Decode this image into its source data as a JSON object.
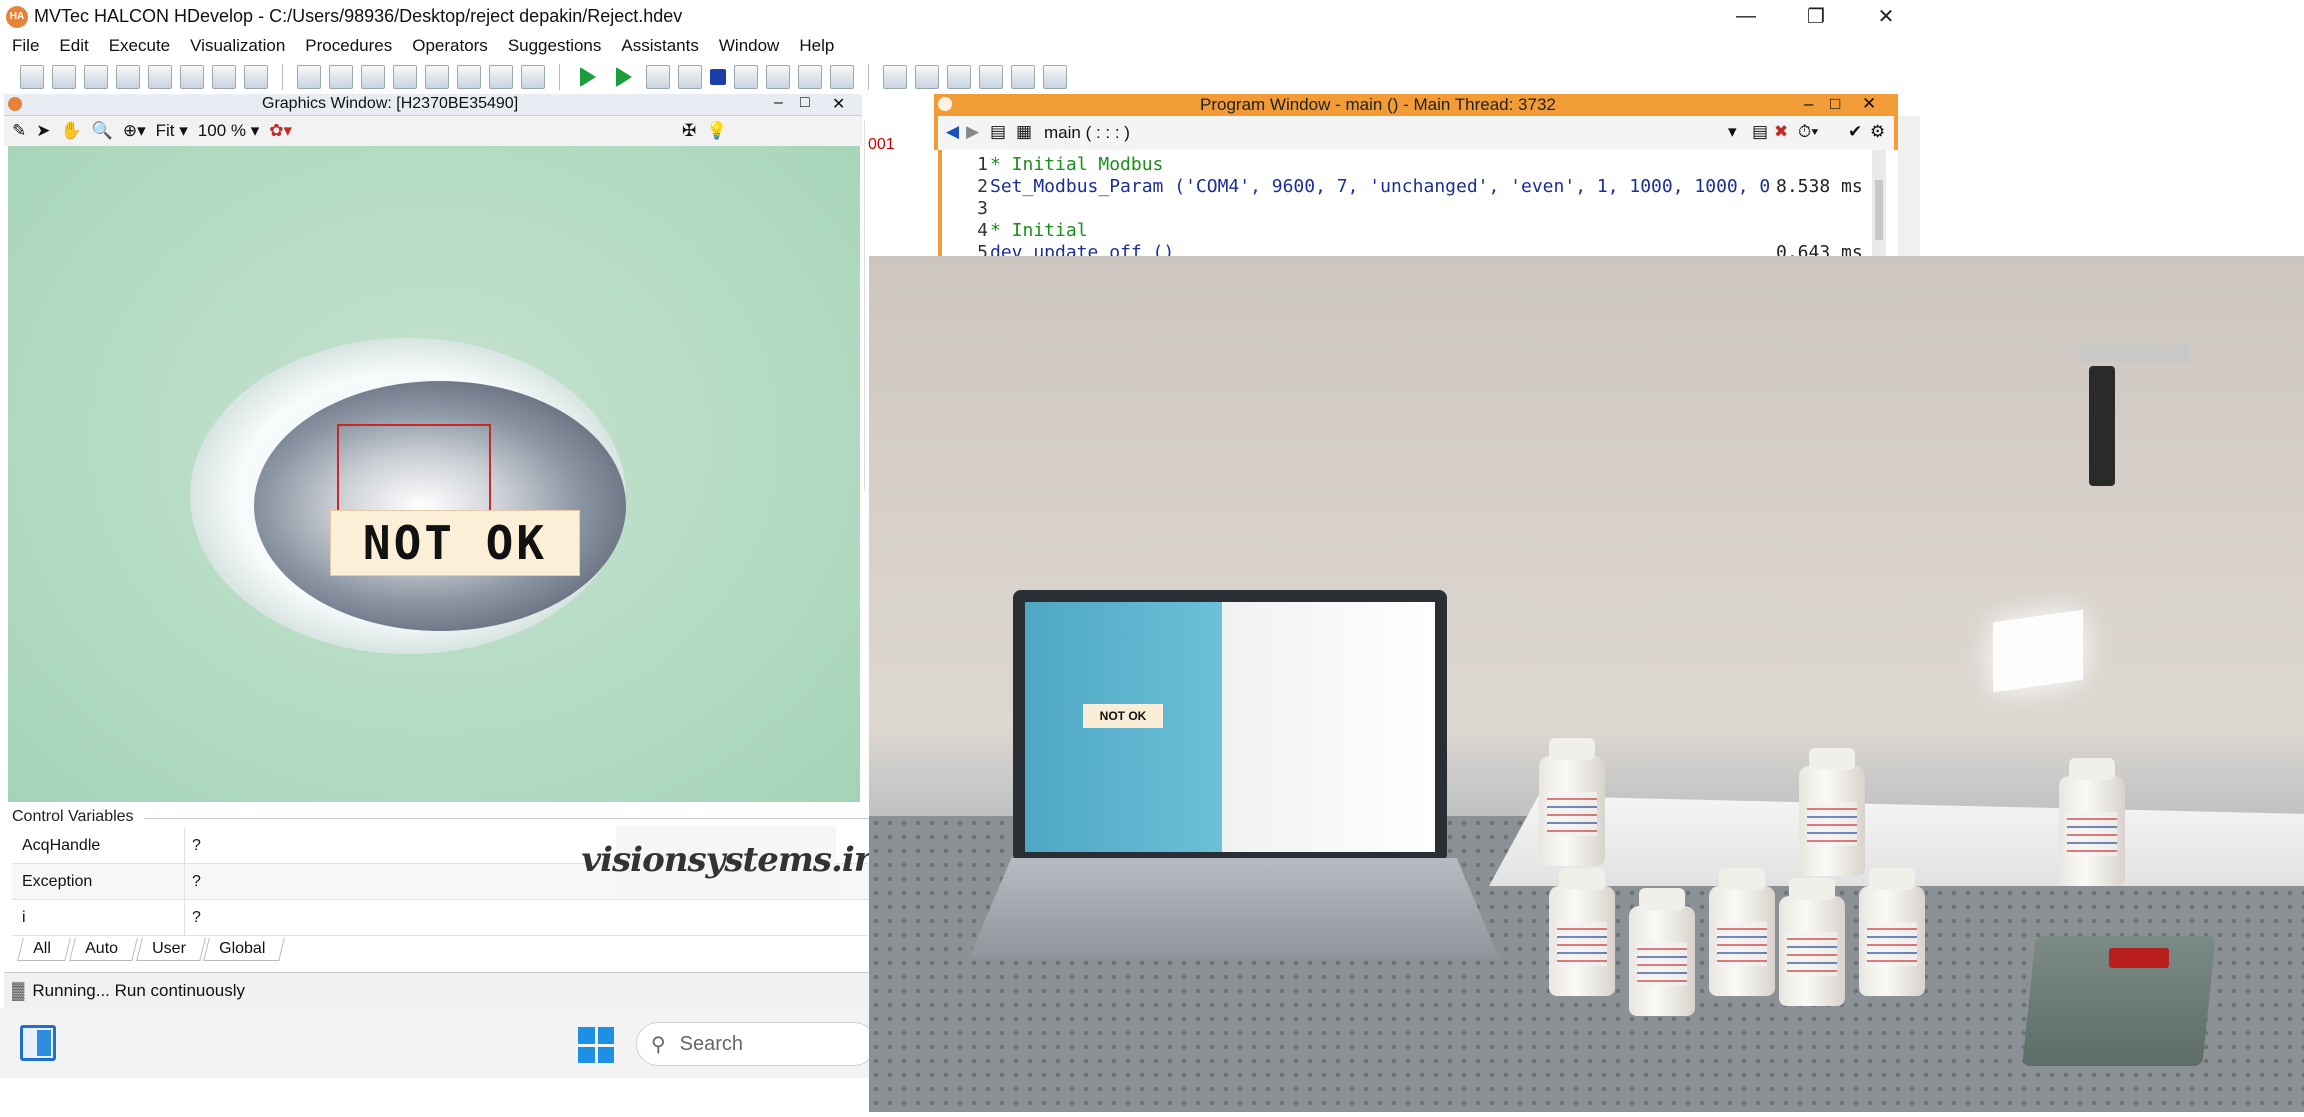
{
  "app": {
    "title": "MVTec HALCON HDevelop - C:/Users/98936/Desktop/reject depakin/Reject.hdev",
    "logo_text": "HA"
  },
  "menu": [
    "File",
    "Edit",
    "Execute",
    "Visualization",
    "Procedures",
    "Operators",
    "Suggestions",
    "Assistants",
    "Window",
    "Help"
  ],
  "graphics_window": {
    "title": "Graphics Window: [H2370BE35490]",
    "zoom_mode": "Fit",
    "zoom_percent": "100 %",
    "result_label": "NOT OK"
  },
  "control_variables": {
    "title": "Control Variables",
    "rows": [
      {
        "name": "AcqHandle",
        "value": "?"
      },
      {
        "name": "Exception",
        "value": "?"
      },
      {
        "name": "i",
        "value": "?"
      }
    ],
    "tabs": [
      "All",
      "Auto",
      "User",
      "Global"
    ]
  },
  "watermark": "visionsystems.ir",
  "status": {
    "text": "Running... Run continuously"
  },
  "taskbar": {
    "search_placeholder": "Search"
  },
  "background_window": {
    "fragment": "001"
  },
  "program_window": {
    "title": "Program Window - main () - Main Thread: 3732",
    "procedure": "main ( : : : )",
    "lines": [
      {
        "num": "1",
        "text": "* Initial Modbus",
        "kind": "cmt",
        "time": ""
      },
      {
        "num": "2",
        "text": "Set_Modbus_Param ('COM4', 9600, 7, 'unchanged', 'even', 1, 1000, 1000, 0",
        "kind": "cop",
        "time": "8.538 ms"
      },
      {
        "num": "3",
        "text": "",
        "kind": "cop",
        "time": ""
      },
      {
        "num": "4",
        "text": "* Initial",
        "kind": "cmt",
        "time": ""
      },
      {
        "num": "5",
        "text": "dev_update_off ()",
        "kind": "cop",
        "time": "0.643 ms"
      }
    ]
  },
  "photo": {
    "screen_label": "NOT OK"
  },
  "colors": {
    "accent_orange": "#f29c38",
    "roi_red": "#c42b26",
    "comment_green": "#1a8f1a",
    "operator_blue": "#1a2e9a"
  }
}
